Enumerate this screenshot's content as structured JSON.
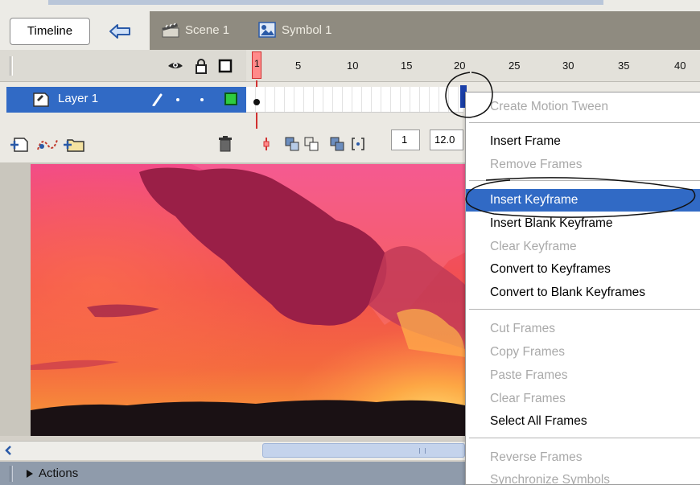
{
  "toolbar": {
    "timeline_label": "Timeline",
    "scene_label": "Scene 1",
    "symbol_label": "Symbol 1"
  },
  "timeline": {
    "ruler_labels": [
      "1",
      "5",
      "10",
      "15",
      "20",
      "25",
      "30",
      "35",
      "40"
    ],
    "layer_name": "Layer 1",
    "current_frame": "1",
    "frame_rate": "12.0"
  },
  "actions_panel": {
    "label": "Actions"
  },
  "context_menu": {
    "items": [
      {
        "label": "Create Motion Tween",
        "enabled": false
      },
      {
        "label": "Insert Frame",
        "enabled": true
      },
      {
        "label": "Remove Frames",
        "enabled": false
      },
      {
        "label": "Insert Keyframe",
        "enabled": true,
        "highlighted": true
      },
      {
        "label": "Insert Blank Keyframe",
        "enabled": true
      },
      {
        "label": "Clear Keyframe",
        "enabled": false
      },
      {
        "label": "Convert to Keyframes",
        "enabled": true
      },
      {
        "label": "Convert to Blank Keyframes",
        "enabled": true
      },
      {
        "label": "Cut Frames",
        "enabled": false
      },
      {
        "label": "Copy Frames",
        "enabled": false
      },
      {
        "label": "Paste Frames",
        "enabled": false
      },
      {
        "label": "Clear Frames",
        "enabled": false
      },
      {
        "label": "Select All Frames",
        "enabled": true
      },
      {
        "label": "Reverse Frames",
        "enabled": false
      },
      {
        "label": "Synchronize Symbols",
        "enabled": false
      }
    ]
  },
  "colors": {
    "selection": "#316ac5",
    "disabled_text": "#a9a9a9",
    "playhead": "#ff8a8a"
  }
}
